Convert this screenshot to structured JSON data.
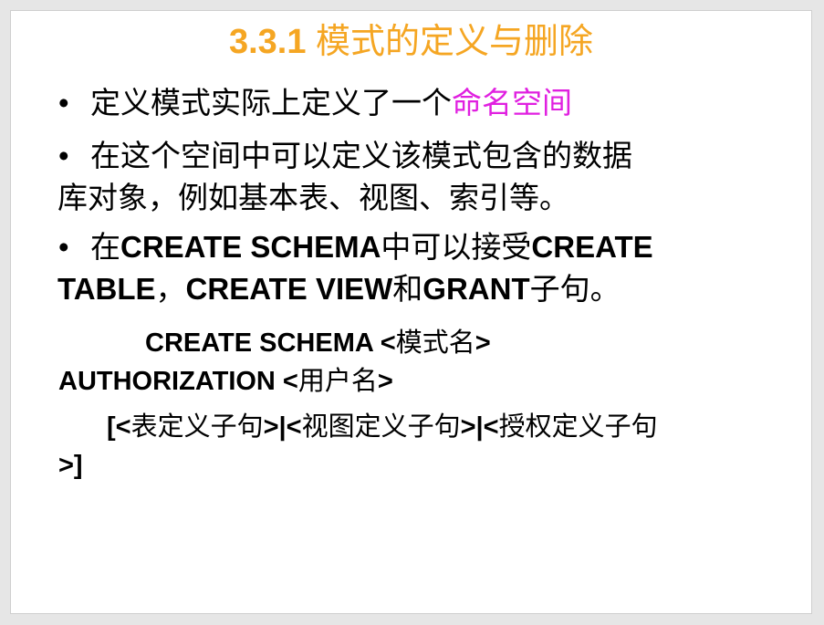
{
  "slide": {
    "title_number": "3.3.1",
    "title_text": "模式的定义与删除",
    "bullets": {
      "b1_prefix": "定义模式实际上定义了一个",
      "b1_highlight": "命名空间",
      "b2_line1": "在这个空间中可以定义该模式包含的数据",
      "b2_line2": "库对象，例如基本表、视图、索引等。",
      "b3_l1_a": "在",
      "b3_l1_b": "CREATE SCHEMA",
      "b3_l1_c": "中可以接受",
      "b3_l1_d": "CREATE",
      "b3_l2_a": "TABLE",
      "b3_l2_b": "，",
      "b3_l2_c": "CREATE VIEW",
      "b3_l2_d": "和",
      "b3_l2_e": "GRANT",
      "b3_l2_f": "子句。"
    },
    "syntax": {
      "l1_a": "CREATE SCHEMA <",
      "l1_b": "模式名",
      "l1_c": ">",
      "l2_a": "AUTHORIZATION <",
      "l2_b": "用户名",
      "l2_c": ">",
      "l3_a": "[<",
      "l3_b": "表定义子句",
      "l3_c": ">|<",
      "l3_d": "视图定义子句",
      "l3_e": ">|<",
      "l3_f": "授权定义子句",
      "l4_a": ">]"
    },
    "bullet_symbol": "•",
    "colors": {
      "title": "#f5a623",
      "highlight": "#e020e0"
    }
  }
}
